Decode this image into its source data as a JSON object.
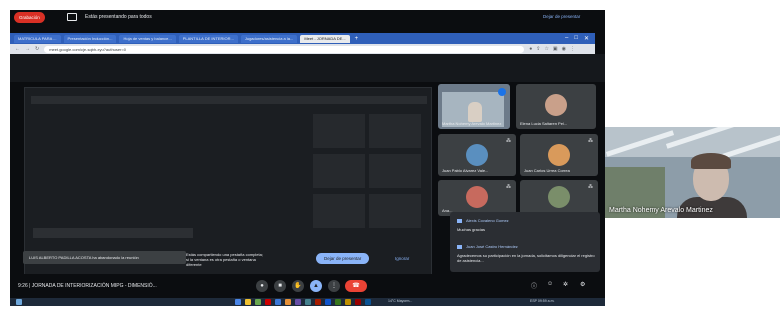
{
  "browser": {
    "tabs": [
      {
        "label": "MATRICULA PARA ..."
      },
      {
        "label": "Presentación Inducción..."
      },
      {
        "label": "Hoja de ventas y balance..."
      },
      {
        "label": "PLANTILLA DE INTERIOR..."
      },
      {
        "label": "Jugadores/asistencia a la..."
      },
      {
        "label": "Meet - JORNADA DE...",
        "active": true
      }
    ],
    "url": "meet.google.com/cje-sqbh-xyu?authuser=0"
  },
  "meet": {
    "recording_label": "Grabación",
    "presenting_label": "Estás presentando para todos",
    "stop_presenting": "Dejar de presentar",
    "leave_toast": "LUIS ALBERTO PADILLA ACOSTA ha abandonado la reunión",
    "share_warning": "Estás compartiendo una pestaña completa; si la ventana es otra pestaña o ventana diferente",
    "dejar_button": "Dejar de presentar",
    "ignorar_button": "Ignorar",
    "meeting_info": "9:26  |  JORNADA DE INTERIORIZACIÓN MIPG - DIMENSIÓ...",
    "participants": [
      {
        "name": "Martha Nohemy Arevalo Martinez",
        "video": true
      },
      {
        "name": "Elena Lucia Saltaren Pel..."
      },
      {
        "name": "Juan Pablo Alvarez Vale..."
      },
      {
        "name": "Juan Carlos Urrea Correa"
      },
      {
        "name": "Ana..."
      },
      {
        "name": ""
      }
    ],
    "chat": [
      {
        "author": "Alexis Covaleno Gomez",
        "text": "Muchas gracias"
      },
      {
        "author": "Juan José Castro Hernández",
        "text": "Agradecemos su participación en la jornada, solicitamos diligenciar el registro de asistencia..."
      }
    ]
  },
  "floating_cam": {
    "name": "Martha Nohemy Arevalo Martinez"
  },
  "taskbar": {
    "weather": "14°C Mayorm...",
    "clock": "ESP 09:59 a.m."
  },
  "colors": {
    "meet_bg": "#0b0d10",
    "accent_blue": "#8ab4f8",
    "record_red": "#d93025",
    "end_call_red": "#ea4335"
  }
}
